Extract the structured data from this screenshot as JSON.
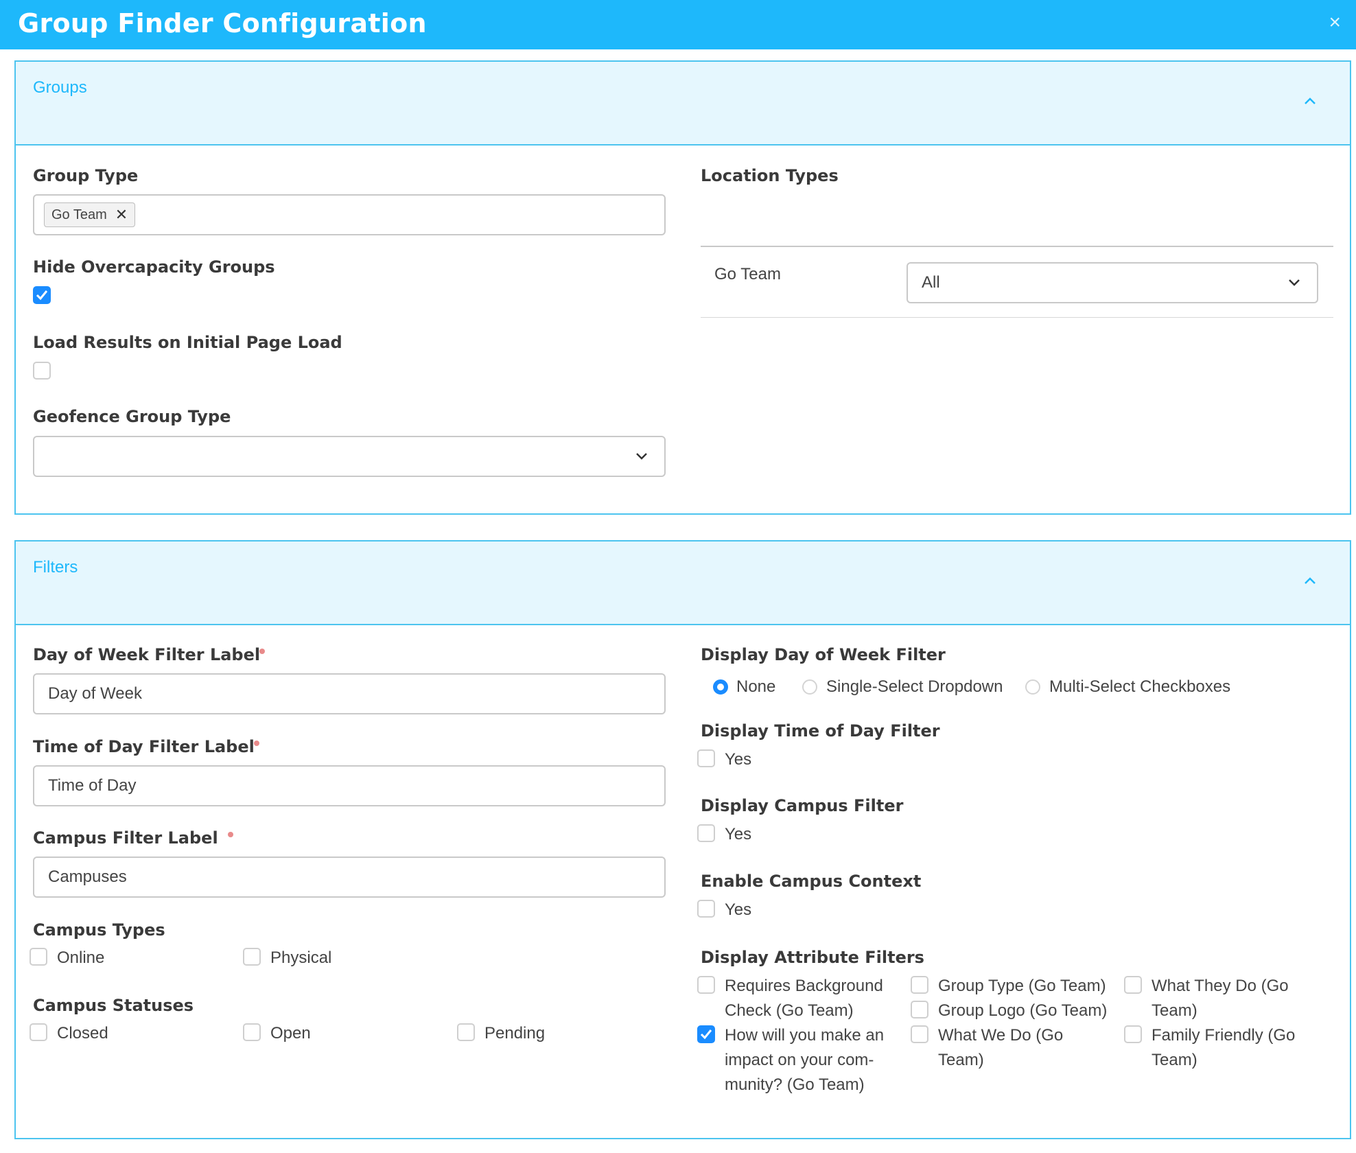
{
  "header": {
    "title": "Group Finder Configuration",
    "close": "×"
  },
  "groups_panel": {
    "title": "Groups",
    "group_type": {
      "label": "Group Type",
      "tags": [
        "Go Team"
      ]
    },
    "hide_overcapacity": {
      "label": "Hide Overcapacity Groups",
      "checked": true
    },
    "load_results": {
      "label": "Load Results on Initial Page Load",
      "checked": false
    },
    "geofence": {
      "label": "Geofence Group Type",
      "value": ""
    },
    "location_types": {
      "label": "Location Types",
      "row_name": "Go Team",
      "value": "All"
    }
  },
  "filters_panel": {
    "title": "Filters",
    "day_of_week_label": {
      "label": "Day of Week Filter Label",
      "value": "Day of Week"
    },
    "time_of_day_label": {
      "label": "Time of Day Filter Label",
      "value": "Time of Day"
    },
    "campus_label": {
      "label": "Campus Filter Label",
      "value": "Campuses"
    },
    "campus_types": {
      "label": "Campus Types",
      "options": [
        "Online",
        "Physical"
      ]
    },
    "campus_statuses": {
      "label": "Campus Statuses",
      "options": [
        "Closed",
        "Open",
        "Pending"
      ]
    },
    "display_day_of_week": {
      "label": "Display Day of Week Filter",
      "options": [
        "None",
        "Single-Select Dropdown",
        "Multi-Select Checkboxes"
      ],
      "selected": "None"
    },
    "display_time_of_day": {
      "label": "Display Time of Day Filter",
      "option": "Yes"
    },
    "display_campus": {
      "label": "Display Campus Filter",
      "option": "Yes"
    },
    "enable_campus_context": {
      "label": "Enable Campus Context",
      "option": "Yes"
    },
    "attribute_filters": {
      "label": "Display Attribute Filters",
      "col1": [
        "Requires Background",
        "Check (Go Team)",
        "How will you make an",
        "impact on your com-",
        "munity? (Go Team)"
      ],
      "col2": [
        "Group Type (Go Team)",
        "Group Logo (Go Team)",
        "What We Do (Go",
        "Team)"
      ],
      "col3": [
        "What They Do (Go",
        "Team)",
        "Family Friendly (Go",
        "Team)"
      ],
      "checked": [
        "How will you make an impact on your community? (Go Team)"
      ]
    }
  }
}
